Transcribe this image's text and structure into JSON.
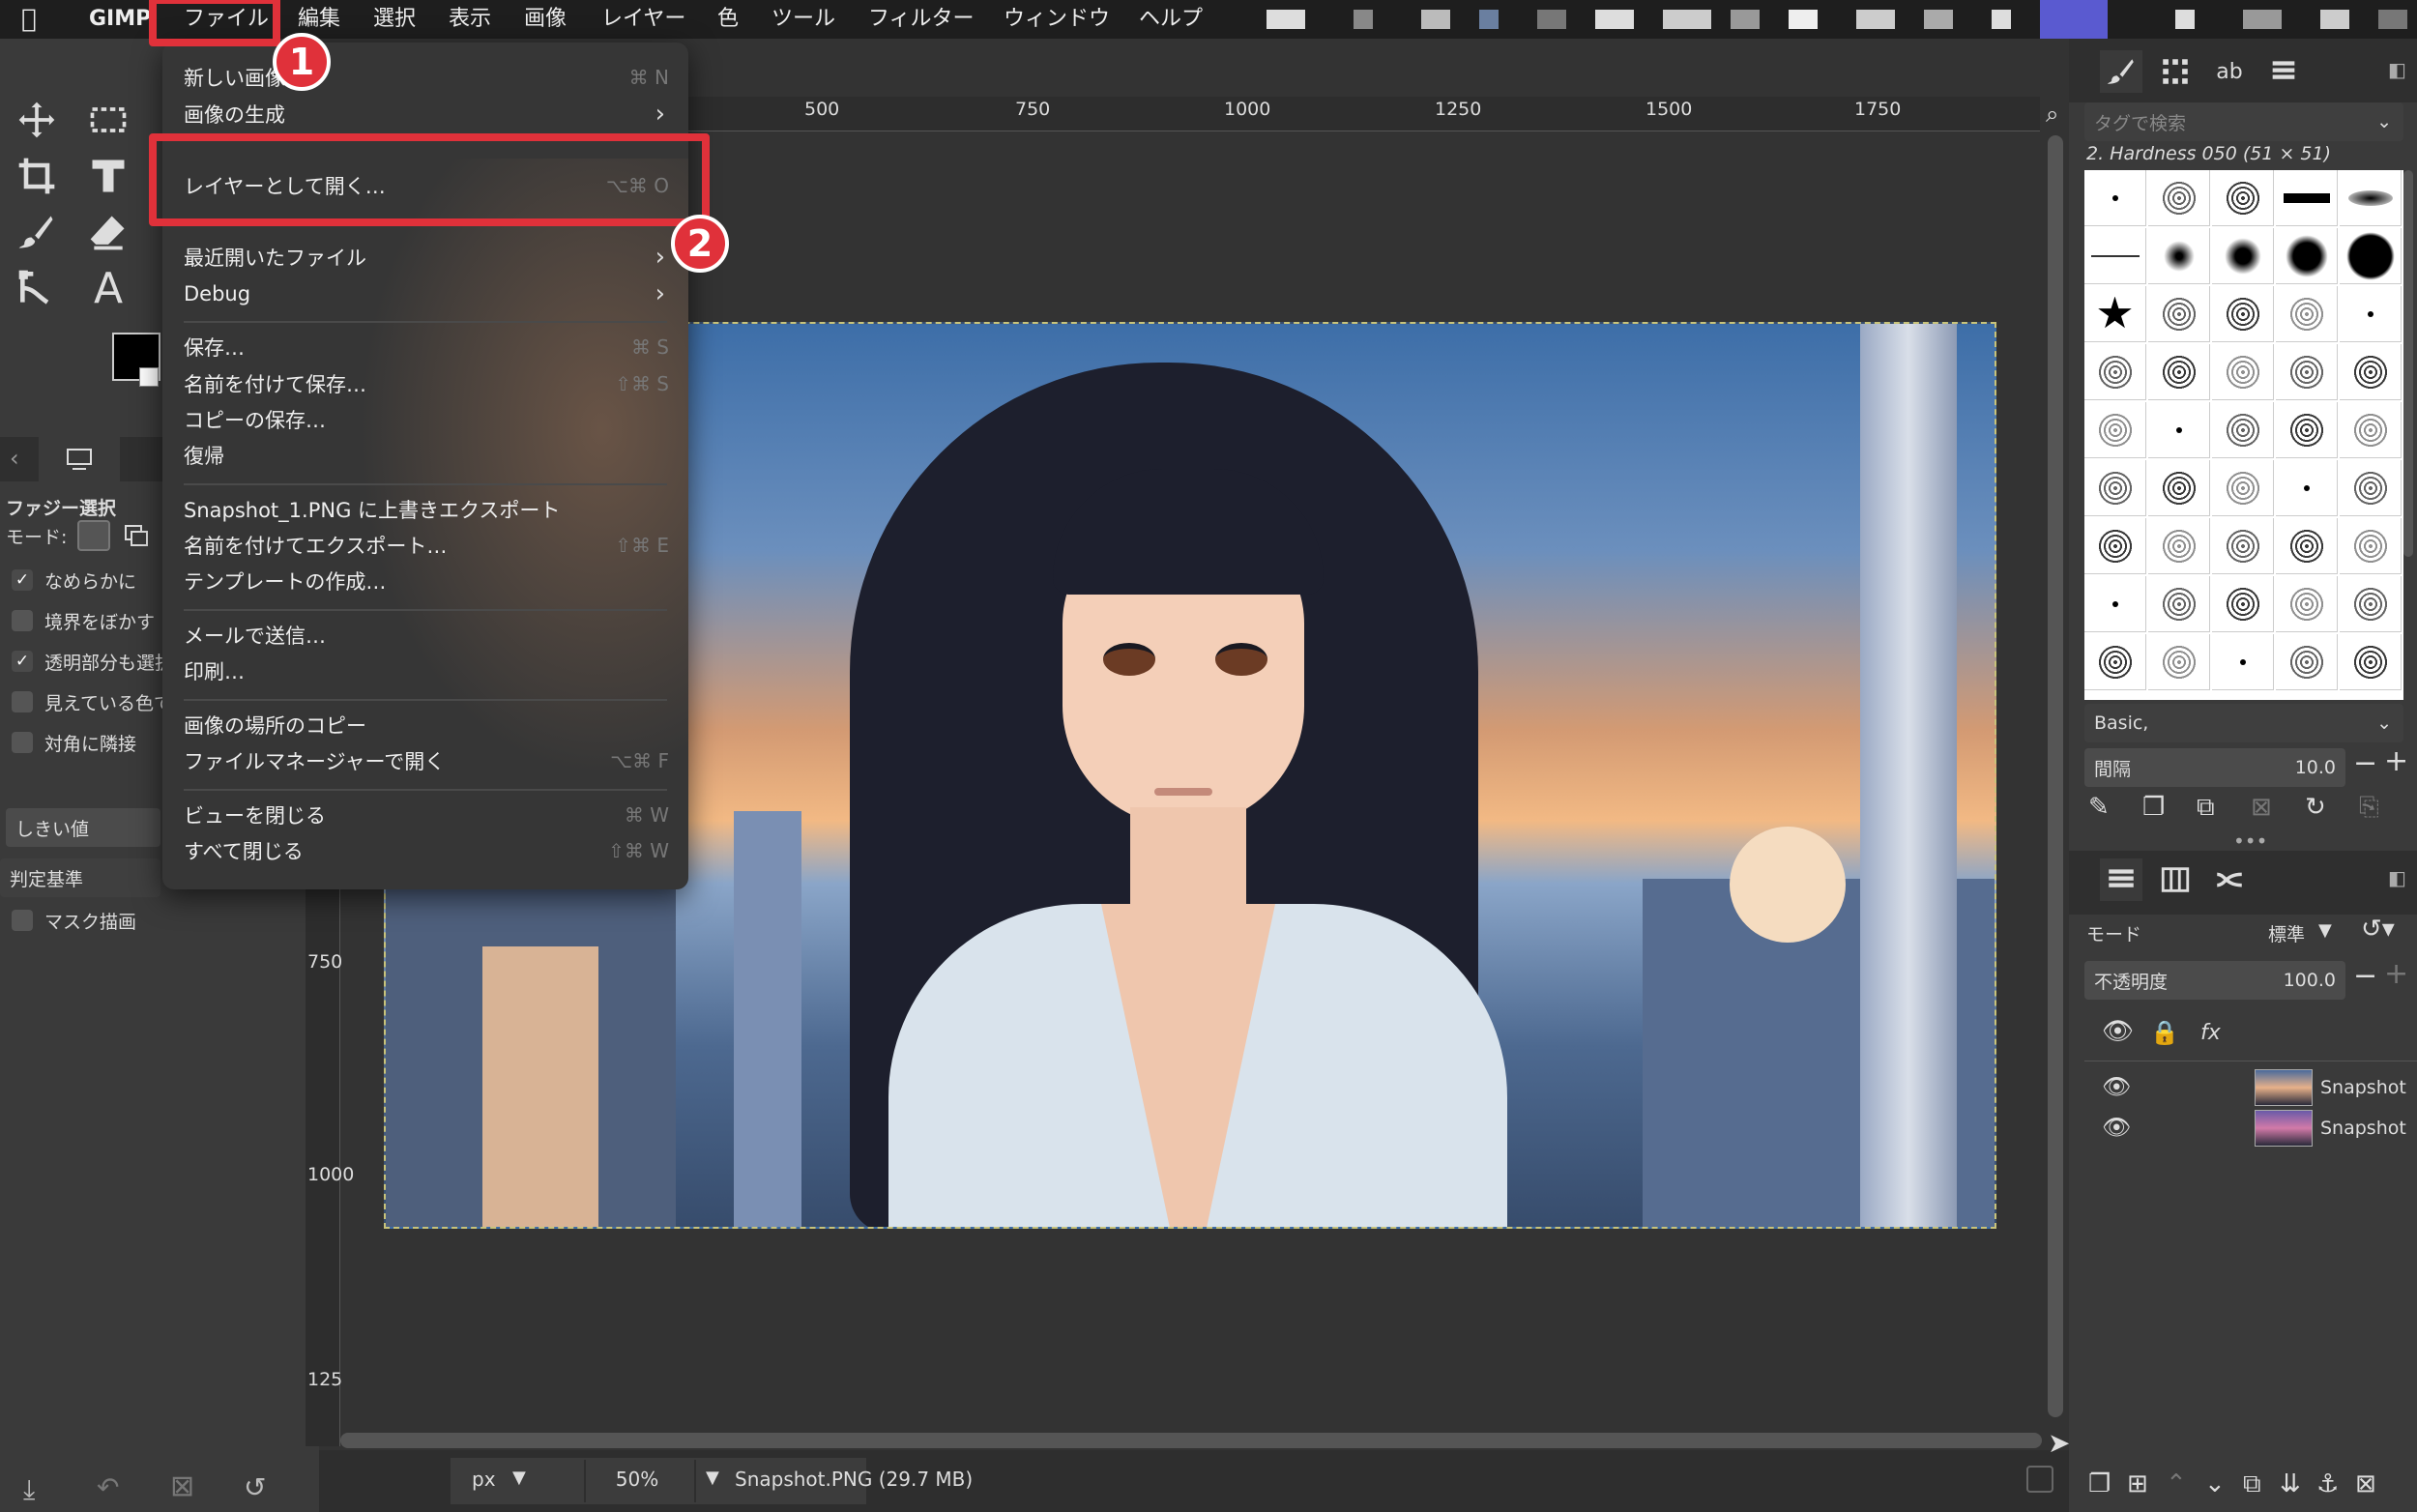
{
  "menubar": {
    "app_name": "GIMP",
    "items": [
      "ファイル",
      "編集",
      "選択",
      "表示",
      "画像",
      "レイヤー",
      "色",
      "ツール",
      "フィルター",
      "ウィンドウ",
      "ヘルプ"
    ]
  },
  "file_menu": {
    "items": [
      {
        "label": "新しい画像",
        "shortcut": "⌘ N"
      },
      {
        "label": "画像の生成",
        "submenu": true
      },
      {
        "label": "レイヤーとして開く…",
        "shortcut": "⌥⌘ O"
      },
      {
        "label": "最近開いたファイル",
        "submenu": true
      },
      {
        "label": "Debug",
        "submenu": true
      },
      {
        "label": "保存…",
        "shortcut": "⌘ S"
      },
      {
        "label": "名前を付けて保存…",
        "shortcut": "⇧⌘ S"
      },
      {
        "label": "コピーの保存…"
      },
      {
        "label": "復帰"
      },
      {
        "label": "Snapshot_1.PNG に上書きエクスポート"
      },
      {
        "label": "名前を付けてエクスポート…",
        "shortcut": "⇧⌘ E"
      },
      {
        "label": "テンプレートの作成…"
      },
      {
        "label": "メールで送信…"
      },
      {
        "label": "印刷…"
      },
      {
        "label": "画像の場所のコピー"
      },
      {
        "label": "ファイルマネージャーで開く",
        "shortcut": "⌥⌘ F"
      },
      {
        "label": "ビューを閉じる",
        "shortcut": "⌘ W"
      },
      {
        "label": "すべて閉じる",
        "shortcut": "⇧⌘ W"
      }
    ]
  },
  "callouts": {
    "badge1": "1",
    "badge2": "2",
    "color": "#e0313a"
  },
  "tool_options": {
    "title": "ファジー選択",
    "mode_label": "モード:",
    "options": [
      {
        "label": "なめらかに",
        "checked": true
      },
      {
        "label": "境界をぼかす",
        "checked": false
      },
      {
        "label": "透明部分も選択",
        "checked": true
      },
      {
        "label": "見えている色で",
        "checked": false
      },
      {
        "label": "対角に隣接",
        "checked": false
      }
    ],
    "threshold_label": "しきい値",
    "criterion_label": "判定基準",
    "draw_mask_label": "マスク描画"
  },
  "ruler": {
    "top_labels": [
      "500",
      "750",
      "1000",
      "1250",
      "1500",
      "1750"
    ],
    "left_labels": [
      "750",
      "1000",
      "125"
    ]
  },
  "status": {
    "unit": "px",
    "zoom": "50%",
    "file_info": "Snapshot.PNG (29.7 MB)"
  },
  "brushes": {
    "search_placeholder": "タグで検索",
    "selected_brush": "2. Hardness 050 (51 × 51)",
    "preset": "Basic,",
    "spacing_label": "間隔",
    "spacing_value": "10.0"
  },
  "layers": {
    "mode_label": "モード",
    "mode_value": "標準",
    "opacity_label": "不透明度",
    "opacity_value": "100.0",
    "items": [
      {
        "name": "Snapshot"
      },
      {
        "name": "Snapshot"
      }
    ]
  },
  "colors": {
    "accent": "#e0313a",
    "selection": "#c8c37a"
  }
}
